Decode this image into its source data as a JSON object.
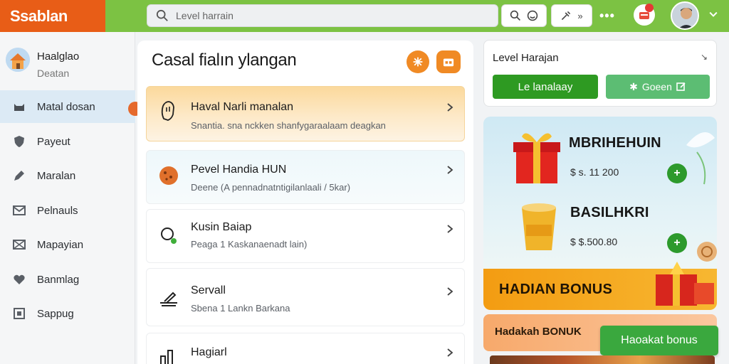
{
  "app": {
    "logo_text": "Ssablan"
  },
  "search": {
    "placeholder": "Level harrain"
  },
  "topbar": {
    "icon_button_icons": [
      "search-icon",
      "face-icon"
    ],
    "tools_button_label": "»",
    "more_label": "•••"
  },
  "sidebar": {
    "profile": {
      "name": "Haalglao",
      "subtitle": "Deatan"
    },
    "items": [
      {
        "label": "Matal dosan",
        "icon": "cat-icon",
        "active": true
      },
      {
        "label": "Payeut",
        "icon": "shield-icon",
        "active": false
      },
      {
        "label": "Maralan",
        "icon": "pen-icon",
        "active": false
      },
      {
        "label": "Pelnauls",
        "icon": "mail-icon",
        "active": false
      },
      {
        "label": "Mapayian",
        "icon": "envelope-icon",
        "active": false
      },
      {
        "label": "Banmlag",
        "icon": "heart-icon",
        "active": false
      },
      {
        "label": "Sappug",
        "icon": "box-icon",
        "active": false
      }
    ]
  },
  "main": {
    "title": "Casal fialın ylangan",
    "rows": [
      {
        "title": "Haval Narli manalan",
        "subtitle": "Snantia. sna nckken shanfygaraalaam deagkan",
        "icon": "hand-icon"
      },
      {
        "title": "Pevel Handia HUN",
        "subtitle": "Deene (A pennadnatntigilanlaali / 5kar)",
        "icon": "cookie-icon"
      },
      {
        "title": "Kusin Baiap",
        "subtitle": "Peaga 1 Kaskanaenadt lain)",
        "icon": "search-leaf-icon"
      },
      {
        "title": "Servall",
        "subtitle": "Sbena 1 Lankn Barkana",
        "icon": "hammer-icon"
      },
      {
        "title": "Hagiarl",
        "subtitle": "",
        "icon": "chart-icon"
      }
    ]
  },
  "right_panel": {
    "title": "Level Harajan",
    "close_glyph": "↘",
    "primary_button": "Le lanalaay",
    "secondary_button": "Goeen",
    "secondary_glyph": "✱"
  },
  "promo": {
    "items": [
      {
        "name": "MBRIHEHUIN",
        "price": "$ s.  11 200",
        "add": "+"
      },
      {
        "name": "BASILHKRI",
        "price": "$ $.500.80",
        "add": "+"
      }
    ],
    "banner": "HADIAN BONUS"
  },
  "bonus": {
    "label": "Hadakah BONUK",
    "button": "Haoakat bonus"
  },
  "colors": {
    "topbar": "#7cc243",
    "logo_bg": "#e85d17",
    "accent_orange": "#f08a24",
    "green_primary": "#2e9a22",
    "green_secondary": "#5cbd73",
    "sidebar_active": "#dceaf5"
  }
}
